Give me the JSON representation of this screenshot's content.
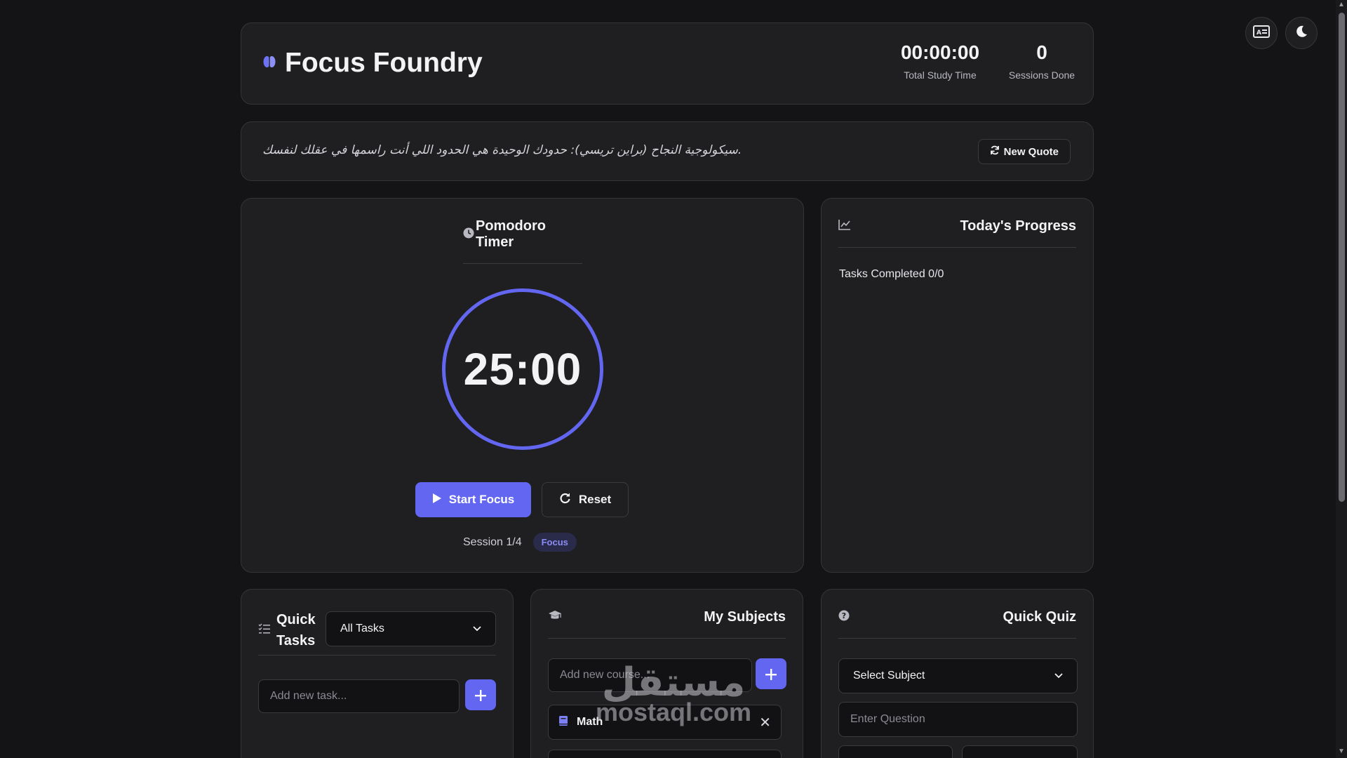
{
  "app": {
    "title": "Focus Foundry",
    "accent_color": "#6366f1"
  },
  "controls": {
    "language_icon": "translate-icon",
    "theme_icon": "moon-icon"
  },
  "stats": {
    "study_time_value": "00:00:00",
    "study_time_label": "Total Study Time",
    "sessions_value": "0",
    "sessions_label": "Sessions Done"
  },
  "quote": {
    "text": ".سيكولوجية النجاح (براين تريسي): حدودك الوحيدة هي الحدود اللي أنت راسمها في عقلك لنفسك",
    "new_quote_label": "New Quote"
  },
  "pomodoro": {
    "title": "Pomodoro Timer",
    "time": "25:00",
    "start_label": "Start Focus",
    "reset_label": "Reset",
    "session_text": "Session 1/4",
    "mode_badge": "Focus"
  },
  "progress": {
    "title": "Today's Progress",
    "tasks_completed": "Tasks Completed 0/0"
  },
  "tasks": {
    "title_line1": "Quick",
    "title_line2": "Tasks",
    "filter_selected": "All Tasks",
    "input_placeholder": "Add new task..."
  },
  "subjects": {
    "title": "My Subjects",
    "input_placeholder": "Add new course...",
    "items": [
      {
        "name": "Math"
      }
    ]
  },
  "quiz": {
    "title": "Quick Quiz",
    "subject_select": "Select Subject",
    "question_placeholder": "Enter Question"
  },
  "watermark": {
    "arabic": "مستقل",
    "latin": "mostaql.com"
  }
}
